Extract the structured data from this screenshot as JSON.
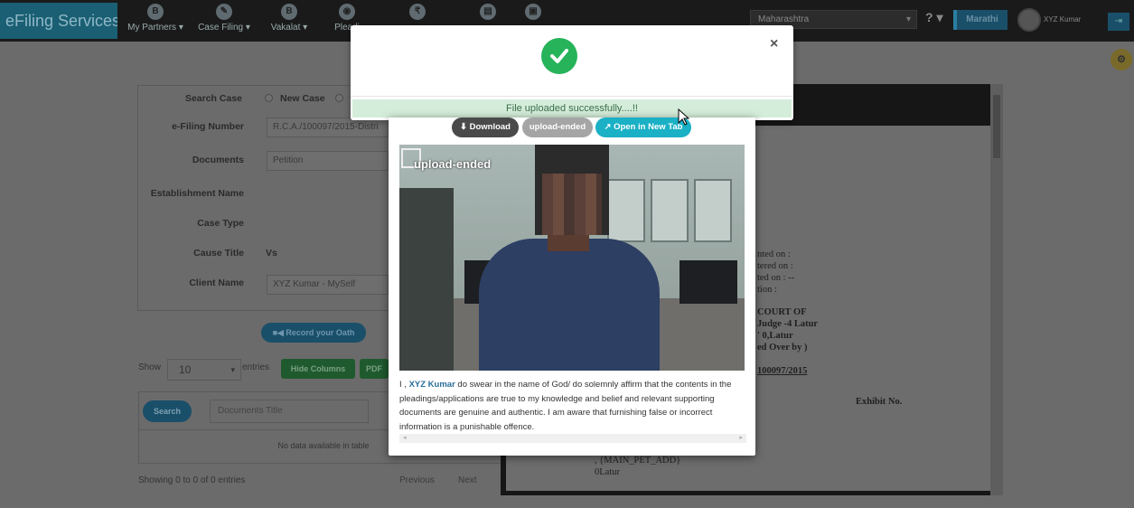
{
  "navbar": {
    "brand": "eFiling Services",
    "items": [
      {
        "icon": "B",
        "label": "My Partners ▾"
      },
      {
        "icon": "✎",
        "label": "Case Filing ▾"
      },
      {
        "icon": "B",
        "label": "Vakalat ▾"
      },
      {
        "icon": "◉",
        "label": "Pleadi"
      }
    ],
    "icon_items": [
      "₹",
      "▤",
      "▣"
    ],
    "state": "Maharashtra",
    "state_caret": "▾",
    "help": "? ▾",
    "language": "Marathi",
    "user": "XYZ Kumar",
    "logout": "⇥"
  },
  "side_badge": "⚙",
  "form": {
    "search_case_label": "Search Case",
    "new_case_label": "New Case",
    "efiling_number_label": "e-Filing Number",
    "efiling_number_value": "R.C.A./100097/2015-Distri",
    "documents_label": "Documents",
    "documents_value": "Petition",
    "establishment_label": "Establishment Name",
    "case_type_label": "Case Type",
    "cause_title_label": "Cause Title",
    "cause_title_value": "Vs",
    "client_name_label": "Client Name",
    "client_name_value": "XYZ Kumar - MySelf"
  },
  "record_oath_button": "■◀ Record your Oath",
  "table_controls": {
    "show_label": "Show",
    "show_value": "10",
    "show_caret": "▾",
    "entries_label": "entries",
    "hide_columns_button": "Hide Columns",
    "pdf_button": "PDF",
    "search_button": "Search",
    "documents_title_placeholder": "Documents Title",
    "no_data": "No data available in table",
    "showing": "Showing 0 to 0 of 0 entries",
    "previous": "Previous",
    "next": "Next"
  },
  "viewer": {
    "lines": [
      "nted on   :",
      "tered on  :",
      "ted on    : --",
      "tion        :"
    ],
    "court_lines": [
      "COURT OF",
      "Judge -4 Latur",
      "' 0,Latur",
      "ed Over by )"
    ],
    "case_number": "100097/2015",
    "exhibit_no": "Exhibit No.",
    "main_pet_add": ", {MAIN_PET_ADD}",
    "latur": "0Latur"
  },
  "alert": {
    "close": "×",
    "message": "File uploaded successfully....!!"
  },
  "modal": {
    "download_button": "⬇ Download",
    "status_badge": "upload-ended",
    "open_new_tab_button": "↗ Open in New Tab",
    "video_overlay": "upload-ended",
    "oath_prefix": "I ,",
    "oath_name": "XYZ Kumar",
    "oath_text": " do swear in the name of God/ do solemnly affirm that the contents in the pleadings/applications are true to my knowledge and belief and relevant supporting documents are genuine and authentic. I am aware that furnishing false or incorrect information is a punishable offence.",
    "hscroll_left": "◂",
    "hscroll_right": "▸"
  },
  "colors": {
    "success_green": "#26b35a",
    "success_bar": "#d4edda",
    "teal_button": "#1ab0c5",
    "brand_bg": "#1a5f73"
  }
}
